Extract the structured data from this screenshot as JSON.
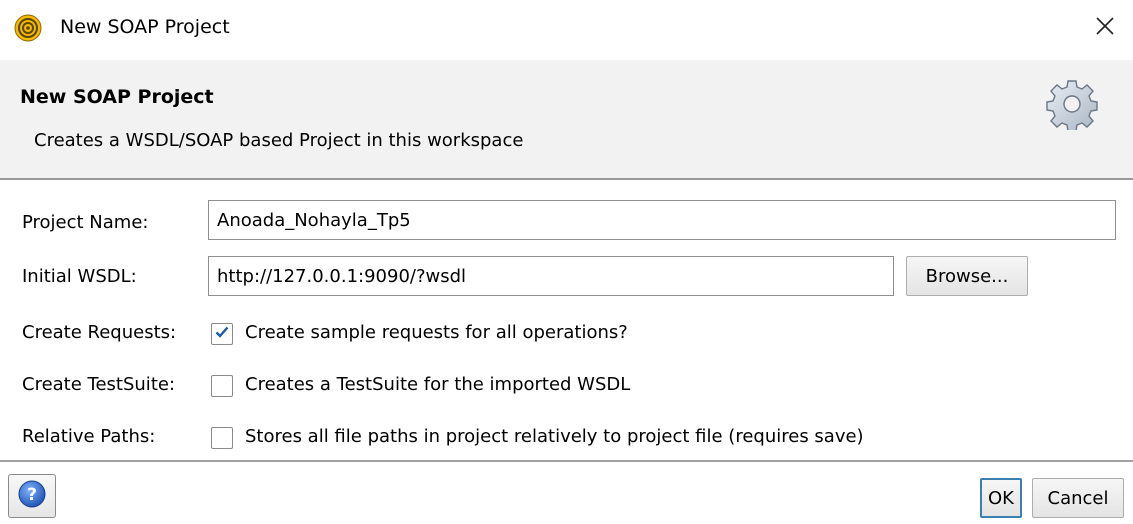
{
  "window": {
    "title": "New SOAP Project",
    "app_icon": "soapui-logo-icon",
    "close_icon": "close-icon"
  },
  "header": {
    "title": "New SOAP Project",
    "description": "Creates a WSDL/SOAP based Project in this workspace",
    "icon": "gear-icon"
  },
  "form": {
    "project_name": {
      "label": "Project Name:",
      "value": "Anoada_Nohayla_Tp5"
    },
    "initial_wsdl": {
      "label": "Initial WSDL:",
      "value": "http://127.0.0.1:9090/?wsdl",
      "browse_label": "Browse..."
    },
    "create_requests": {
      "label": "Create Requests:",
      "checkbox_label": "Create sample requests for all operations?",
      "checked": true
    },
    "create_testsuite": {
      "label": "Create TestSuite:",
      "checkbox_label": "Creates a TestSuite for the imported WSDL",
      "checked": false
    },
    "relative_paths": {
      "label": "Relative Paths:",
      "checkbox_label": "Stores all file paths in project relatively to project file (requires save)",
      "checked": false
    }
  },
  "footer": {
    "help_icon": "help-icon",
    "ok_label": "OK",
    "cancel_label": "Cancel"
  },
  "colors": {
    "accent": "#3c7fb1",
    "header_bg": "#f2f2f2",
    "check_mark": "#1e5aa8"
  }
}
